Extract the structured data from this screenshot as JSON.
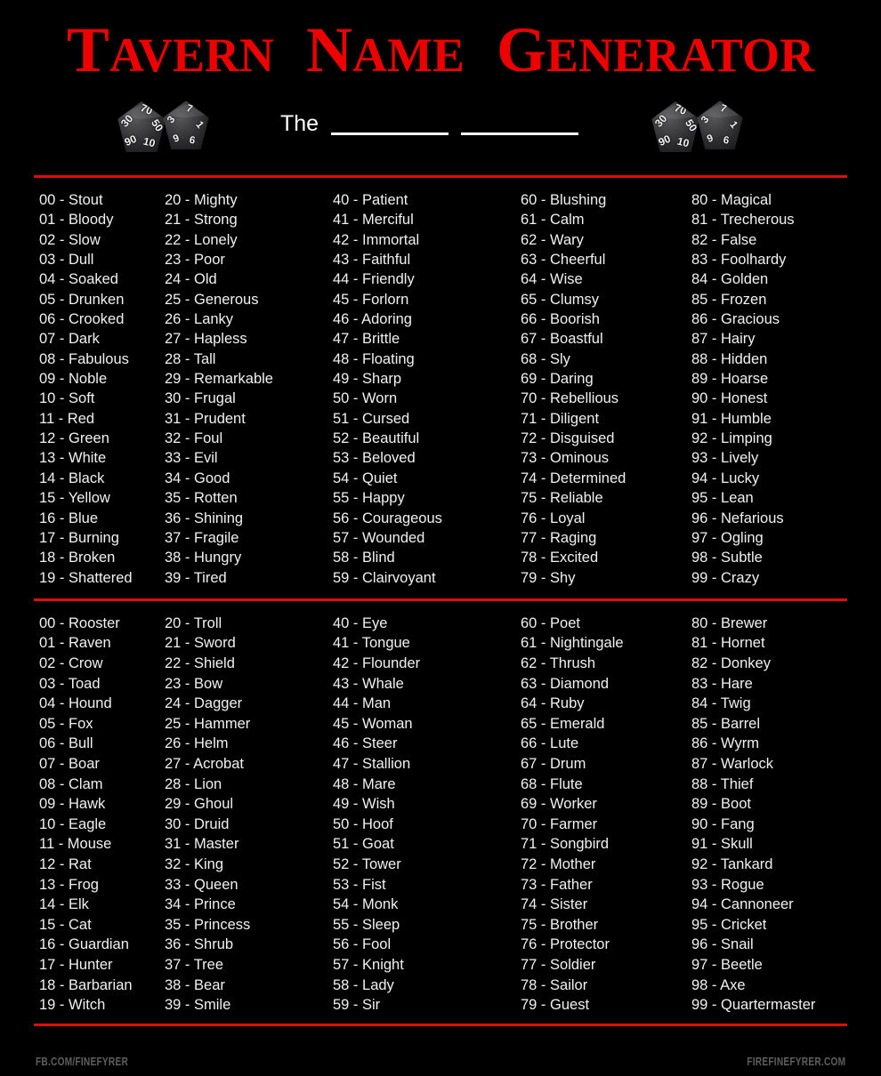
{
  "header": {
    "title": "Tavern Name Generator",
    "title_parts": [
      "T",
      "AVERN",
      "N",
      "AME",
      "G",
      "ENERATOR"
    ],
    "prefix_label": "The",
    "blank1": "",
    "blank2": "",
    "accent_color": "#dd0d0d",
    "title_color": "#ee0000",
    "dice": {
      "left": {
        "die1_faces": [
          "30",
          "70",
          "50",
          "90",
          "10"
        ],
        "die2_faces": [
          "3",
          "7",
          "1",
          "9",
          "6"
        ]
      },
      "right": {
        "die1_faces": [
          "30",
          "70",
          "50",
          "90",
          "10"
        ],
        "die2_faces": [
          "3",
          "7",
          "1",
          "9",
          "6"
        ]
      }
    }
  },
  "table_adjectives": {
    "columns": [
      {
        "entries": [
          "00 - Stout",
          "01 - Bloody",
          "02 - Slow",
          "03 - Dull",
          "04 - Soaked",
          "05 - Drunken",
          "06 - Crooked",
          "07 - Dark",
          "08 - Fabulous",
          "09 - Noble",
          "10 - Soft",
          "11 - Red",
          "12 - Green",
          "13 - White",
          "14 - Black",
          "15 - Yellow",
          "16 - Blue",
          "17 - Burning",
          "18 - Broken",
          "19 - Shattered"
        ]
      },
      {
        "entries": [
          "20 - Mighty",
          "21 - Strong",
          "22 - Lonely",
          "23 - Poor",
          "24 - Old",
          "25 - Generous",
          "26 - Lanky",
          "27 - Hapless",
          "28 - Tall",
          "29 - Remarkable",
          "30 - Frugal",
          "31 - Prudent",
          "32 - Foul",
          "33 - Evil",
          "34 - Good",
          "35 - Rotten",
          "36 - Shining",
          "37 - Fragile",
          "38 - Hungry",
          "39 - Tired"
        ]
      },
      {
        "entries": [
          "40 - Patient",
          "41 - Merciful",
          "42 - Immortal",
          "43 - Faithful",
          "44 - Friendly",
          "45 - Forlorn",
          "46 - Adoring",
          "47 - Brittle",
          "48 - Floating",
          "49 - Sharp",
          "50 - Worn",
          "51 - Cursed",
          "52 - Beautiful",
          "53 - Beloved",
          "54 - Quiet",
          "55 - Happy",
          "56 - Courageous",
          "57 - Wounded",
          "58 - Blind",
          "59 - Clairvoyant"
        ]
      },
      {
        "entries": [
          "60 - Blushing",
          "61 - Calm",
          "62 - Wary",
          "63 - Cheerful",
          "64 - Wise",
          "65 - Clumsy",
          "66 - Boorish",
          "67 - Boastful",
          "68 - Sly",
          "69 - Daring",
          "70 - Rebellious",
          "71 - Diligent",
          "72 - Disguised",
          "73 - Ominous",
          "74 - Determined",
          "75 - Reliable",
          "76 - Loyal",
          "77 - Raging",
          "78 - Excited",
          "79 - Shy"
        ]
      },
      {
        "entries": [
          "80 - Magical",
          "81 - Trecherous",
          "82 - False",
          "83 - Foolhardy",
          "84 - Golden",
          "85 - Frozen",
          "86 - Gracious",
          "87 - Hairy",
          "88 - Hidden",
          "89 - Hoarse",
          "90 - Honest",
          "91 - Humble",
          "92 - Limping",
          "93 - Lively",
          "94 - Lucky",
          "95 - Lean",
          "96 - Nefarious",
          "97 - Ogling",
          "98 - Subtle",
          "99 - Crazy"
        ]
      }
    ]
  },
  "table_nouns": {
    "columns": [
      {
        "entries": [
          "00 - Rooster",
          "01 - Raven",
          "02 - Crow",
          "03 - Toad",
          "04 - Hound",
          "05 - Fox",
          "06 - Bull",
          "07 - Boar",
          "08 - Clam",
          "09 - Hawk",
          "10 - Eagle",
          "11 - Mouse",
          "12 - Rat",
          "13 - Frog",
          "14 - Elk",
          "15 - Cat",
          "16 - Guardian",
          "17 - Hunter",
          "18 - Barbarian",
          "19 - Witch"
        ]
      },
      {
        "entries": [
          "20 - Troll",
          "21 - Sword",
          "22 - Shield",
          "23 - Bow",
          "24 - Dagger",
          "25 - Hammer",
          "26 - Helm",
          "27 - Acrobat",
          "28 - Lion",
          "29 - Ghoul",
          "30 - Druid",
          "31 - Master",
          "32 - King",
          "33 - Queen",
          "34 - Prince",
          "35 - Princess",
          "36 - Shrub",
          "37 - Tree",
          "38 - Bear",
          "39 - Smile"
        ]
      },
      {
        "entries": [
          "40 - Eye",
          "41 - Tongue",
          "42 - Flounder",
          "43 - Whale",
          "44 - Man",
          "45 - Woman",
          "46 - Steer",
          "47 - Stallion",
          "48 - Mare",
          "49 - Wish",
          "50 - Hoof",
          "51 - Goat",
          "52 - Tower",
          "53 - Fist",
          "54 - Monk",
          "55 - Sleep",
          "56 - Fool",
          "57 - Knight",
          "58 - Lady",
          "59 - Sir"
        ]
      },
      {
        "entries": [
          "60 - Poet",
          "61 - Nightingale",
          "62 - Thrush",
          "63 - Diamond",
          "64 - Ruby",
          "65 - Emerald",
          "66 - Lute",
          "67 - Drum",
          "68 - Flute",
          "69 - Worker",
          "70 - Farmer",
          "71 - Songbird",
          "72 - Mother",
          "73 - Father",
          "74 - Sister",
          "75 - Brother",
          "76 - Protector",
          "77 - Soldier",
          "78 - Sailor",
          "79 - Guest"
        ]
      },
      {
        "entries": [
          "80 - Brewer",
          "81 - Hornet",
          "82 - Donkey",
          "83 - Hare",
          "84 - Twig",
          "85 - Barrel",
          "86 - Wyrm",
          "87 - Warlock",
          "88 - Thief",
          "89 - Boot",
          "90 - Fang",
          "91 - Skull",
          "92 - Tankard",
          "93 - Rogue",
          "94 - Cannoneer",
          "95 - Cricket",
          "96 - Snail",
          "97 - Beetle",
          "98 - Axe",
          "99 - Quartermaster"
        ]
      }
    ]
  },
  "footer": {
    "left": "FB.COM/FINEFYRER",
    "right": "FIREFINEFYRER.COM"
  }
}
